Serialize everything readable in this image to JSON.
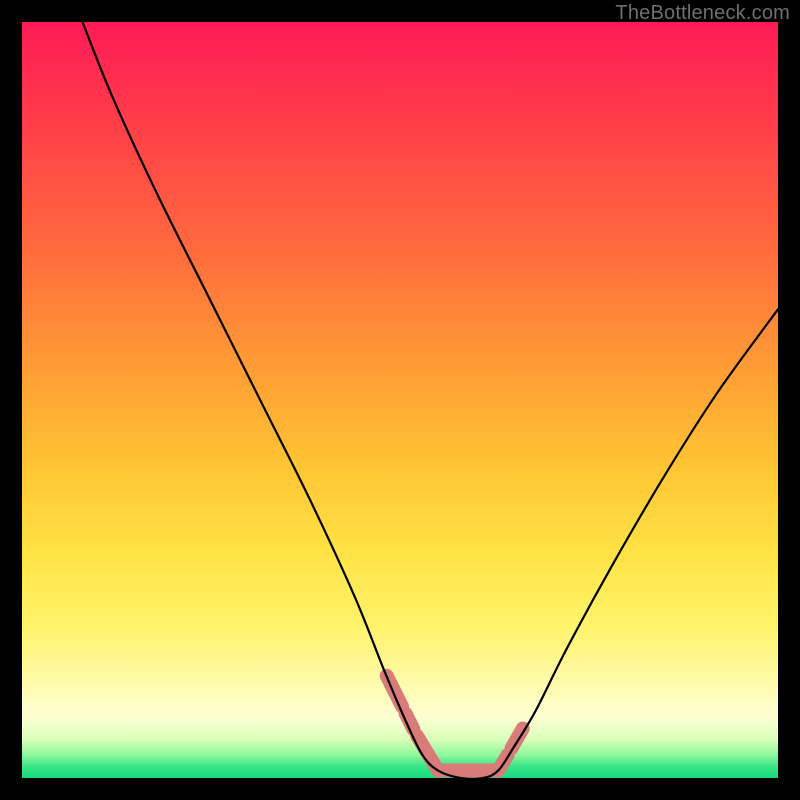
{
  "watermark": "TheBottleneck.com",
  "chart_data": {
    "type": "line",
    "title": "",
    "xlabel": "",
    "ylabel": "",
    "xlim": [
      0,
      100
    ],
    "ylim": [
      0,
      100
    ],
    "grid": false,
    "legend": false,
    "notes": "V-shaped bottleneck curve over a vertical red→yellow→green gradient. y≈0 (green) near the valley x≈55–63; curve rises steeply toward y≈100 as x→0 and more gently toward the right edge.",
    "series": [
      {
        "name": "bottleneck-curve",
        "x": [
          8,
          12,
          18,
          25,
          32,
          38,
          44,
          48,
          51,
          53,
          55,
          58,
          61,
          63,
          65,
          68,
          72,
          78,
          85,
          92,
          100
        ],
        "y": [
          100,
          90,
          77,
          63,
          49,
          37,
          24,
          14,
          7,
          3,
          1,
          0,
          0,
          1,
          4,
          9,
          17,
          28,
          40,
          51,
          62
        ]
      }
    ],
    "valley_markers": {
      "description": "coral dash/dot overlay tracing the valley region of the curve",
      "x": [
        48,
        50.5,
        52,
        55,
        58,
        61,
        63,
        64.5,
        66.5
      ],
      "y": [
        14,
        9,
        6,
        1,
        0,
        0,
        1,
        3.5,
        7
      ]
    },
    "background_gradient_stops": [
      {
        "pos": 0.0,
        "color": "#ff1a57"
      },
      {
        "pos": 0.3,
        "color": "#ff6a3d"
      },
      {
        "pos": 0.58,
        "color": "#ffc233"
      },
      {
        "pos": 0.8,
        "color": "#fff36a"
      },
      {
        "pos": 0.92,
        "color": "#fdffd4"
      },
      {
        "pos": 1.0,
        "color": "#17db80"
      }
    ]
  }
}
